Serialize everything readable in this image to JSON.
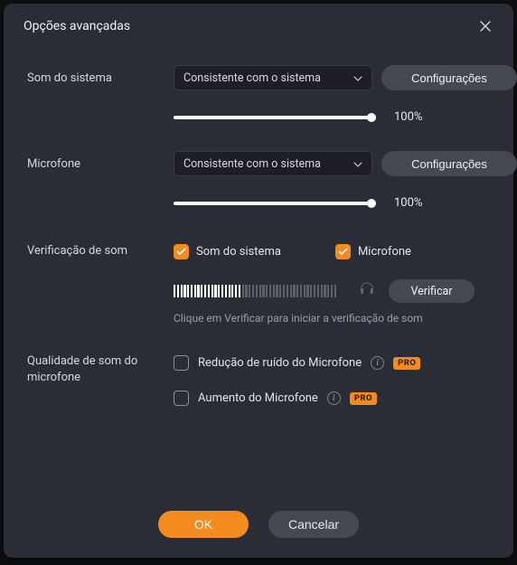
{
  "title": "Opções avançadas",
  "system_sound": {
    "label": "Som do sistema",
    "select_value": "Consistente com o sistema",
    "settings_label": "Configurações",
    "slider_value": 100,
    "slider_display": "100%"
  },
  "microphone": {
    "label": "Microfone",
    "select_value": "Consistente com o sistema",
    "settings_label": "Configurações",
    "slider_value": 100,
    "slider_display": "100%"
  },
  "sound_check": {
    "label": "Verificação de som",
    "system_checkbox_label": "Som do sistema",
    "system_checked": true,
    "mic_checkbox_label": "Microfone",
    "mic_checked": true,
    "verify_button": "Verificar",
    "meter_level": 0.42,
    "hint": "Clique em Verificar para iniciar a verificação de som"
  },
  "mic_quality": {
    "label": "Qualidade de som do microfone",
    "noise_reduction_label": "Redução de ruído do Microfone",
    "noise_reduction_checked": false,
    "boost_label": "Aumento do Microfone",
    "boost_checked": false,
    "pro_badge": "PRO"
  },
  "footer": {
    "ok_label": "OK",
    "cancel_label": "Cancelar"
  },
  "colors": {
    "accent": "#f38b1e",
    "bg": "#2b2d36"
  }
}
